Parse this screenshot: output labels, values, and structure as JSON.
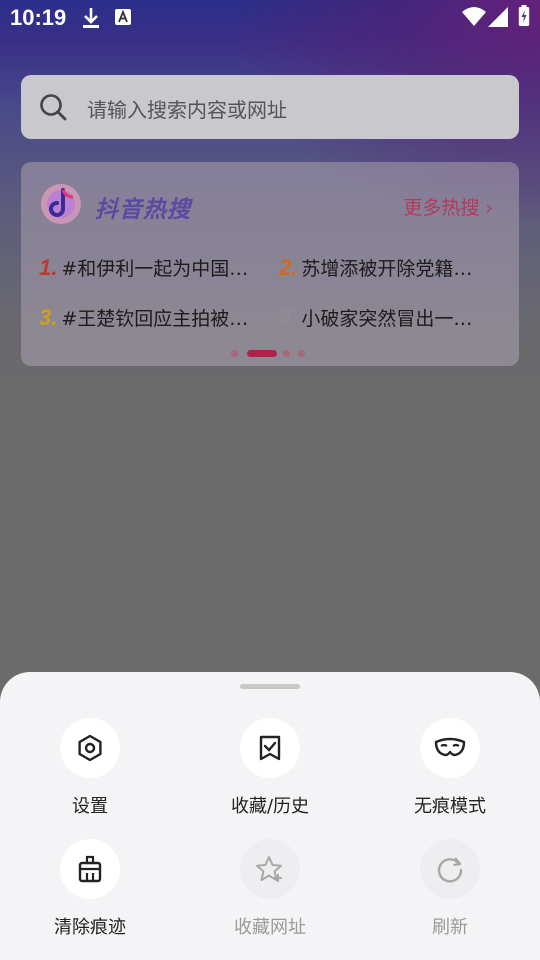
{
  "status_bar": {
    "time": "10:19",
    "icons": [
      "download-icon",
      "a-keyboard-icon",
      "wifi-icon",
      "signal-icon",
      "battery-charging-icon"
    ]
  },
  "search": {
    "placeholder": "请输入搜索内容或网址",
    "icon": "search-icon"
  },
  "hot_card": {
    "title": "抖音热搜",
    "more": "更多热搜 ›",
    "items": [
      {
        "rank": "1.",
        "text": "#和伊利一起为中国…",
        "color": "#c0372e"
      },
      {
        "rank": "2.",
        "text": "苏增添被开除党籍…",
        "color": "#d06a1c"
      },
      {
        "rank": "3.",
        "text": "#王楚钦回应主拍被…",
        "color": "#caa01a"
      },
      {
        "rank": "4.",
        "text": "小破家突然冒出一…",
        "color": "#8d8d93"
      }
    ],
    "page_dots": 4,
    "active_dot": 1
  },
  "menu": {
    "items": [
      {
        "label": "设置",
        "icon": "settings-hexagon-icon",
        "enabled": true
      },
      {
        "label": "收藏/历史",
        "icon": "bookmark-check-icon",
        "enabled": true
      },
      {
        "label": "无痕模式",
        "icon": "incognito-mask-icon",
        "enabled": true
      },
      {
        "label": "清除痕迹",
        "icon": "clear-trash-icon",
        "enabled": true
      },
      {
        "label": "收藏网址",
        "icon": "star-add-icon",
        "enabled": false
      },
      {
        "label": "刷新",
        "icon": "refresh-icon",
        "enabled": false
      }
    ]
  }
}
